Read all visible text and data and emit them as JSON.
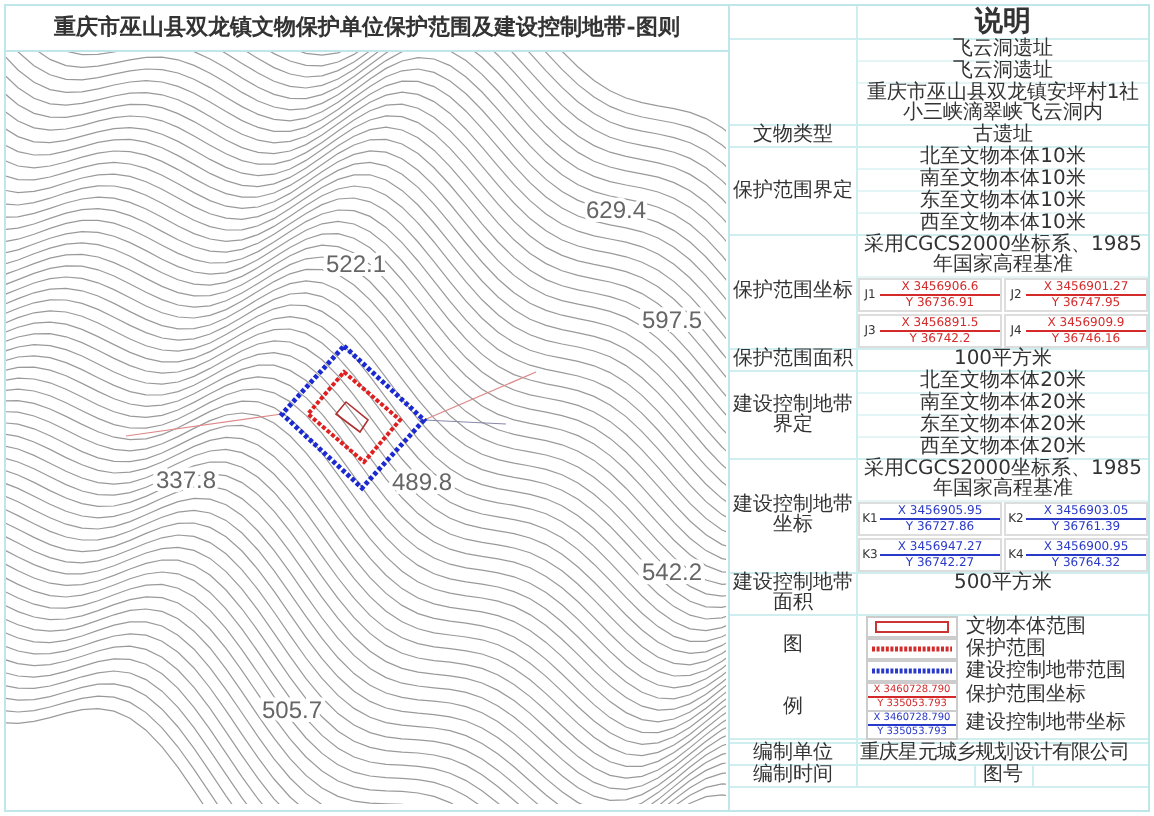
{
  "title": "重庆市巫山县双龙镇文物保护单位保护范围及建设控制地带-图则",
  "map": {
    "elevations": [
      "629.4",
      "522.1",
      "597.5",
      "489.8",
      "337.8",
      "542.2",
      "505.7"
    ]
  },
  "panel": {
    "heading": "说明",
    "sections": [
      {
        "kind": "lines",
        "lines": [
          "飞云洞遗址",
          "飞云洞遗址",
          "重庆市巫山县双龙镇安坪村1社小三峡滴翠峡飞云洞内"
        ]
      },
      {
        "kind": "lines",
        "label": "文物类型",
        "lines": [
          "古遗址"
        ]
      },
      {
        "kind": "lines",
        "label": "保护范围界定",
        "lines": [
          "北至文物本体10米",
          "南至文物本体10米",
          "东至文物本体10米",
          "西至文物本体10米"
        ]
      },
      {
        "kind": "protection-coords",
        "label": "保护范围坐标",
        "note": "采用CGCS2000坐标系、1985年国家高程基准",
        "points": [
          {
            "id": "J1",
            "x": "X 3456906.6",
            "y": "Y 36736.91"
          },
          {
            "id": "J2",
            "x": "X 3456901.27",
            "y": "Y 36747.95"
          },
          {
            "id": "J3",
            "x": "X 3456891.5",
            "y": "Y 36742.2"
          },
          {
            "id": "J4",
            "x": "X 3456909.9",
            "y": "Y 36746.16"
          }
        ]
      },
      {
        "kind": "lines",
        "label": "保护范围面积",
        "lines": [
          "100平方米"
        ]
      },
      {
        "kind": "lines",
        "label": "建设控制地带界定",
        "lines": [
          "北至文物本体20米",
          "南至文物本体20米",
          "东至文物本体20米",
          "西至文物本体20米"
        ]
      },
      {
        "kind": "control-coords",
        "label": "建设控制地带坐标",
        "note": "采用CGCS2000坐标系、1985年国家高程基准",
        "points": [
          {
            "id": "K1",
            "x": "X 3456905.95",
            "y": "Y 36727.86"
          },
          {
            "id": "K2",
            "x": "X 3456903.05",
            "y": "Y 36761.39"
          },
          {
            "id": "K3",
            "x": "X 3456947.27",
            "y": "Y 36742.27"
          },
          {
            "id": "K4",
            "x": "X 3456900.95",
            "y": "Y 36764.32"
          }
        ]
      },
      {
        "kind": "lines",
        "label": "建设控制地带面积",
        "lines": [
          "500平方米"
        ]
      },
      {
        "kind": "legend",
        "labels": [
          "图",
          "例"
        ],
        "entries": [
          {
            "kind": "body",
            "text": "文物本体范围"
          },
          {
            "kind": "protection",
            "text": "保护范围"
          },
          {
            "kind": "control",
            "text": "建设控制地带范围"
          },
          {
            "kind": "protection-coord",
            "text": "保护范围坐标",
            "x": "X 3460728.790",
            "y": "Y 335053.793"
          },
          {
            "kind": "control-coord",
            "text": "建设控制地带坐标",
            "x": "X 3460728.790",
            "y": "Y 335053.793"
          }
        ]
      }
    ],
    "footer": {
      "unit_label": "编制单位",
      "unit": "重庆星元城乡规划设计有限公司",
      "date_label": "编制时间",
      "number_label": "图号"
    }
  }
}
